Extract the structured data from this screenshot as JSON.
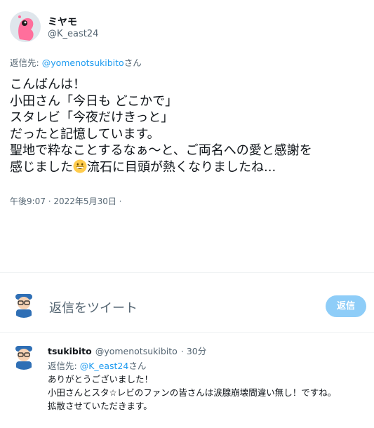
{
  "tweet": {
    "author_name": "ミヤモ",
    "author_handle": "@K_east24",
    "reply_prefix": "返信先: ",
    "reply_mention": "@yomenotsukibito",
    "reply_suffix": "さん",
    "body_lines": [
      "こんばんは！",
      "小田さん「今日も どこかで」",
      "スタレビ「今夜だけきっと」",
      "だったと記憶しています。",
      "聖地で粋なことするなぁ〜と、ご両名への愛と感謝を"
    ],
    "body_last_before": "感じました",
    "body_last_after": "流石に目頭が熱くなりましたね...",
    "emoji_icon": "grinning-face-emoji",
    "timestamp": "午後9:07 · 2022年5月30日 ·"
  },
  "composer": {
    "placeholder": "返信をツイート",
    "reply_button": "返信"
  },
  "reply_tweet": {
    "author_name": "tsukibito",
    "author_handle": "@yomenotsukibito",
    "time_ago": "· 30分",
    "reply_prefix": "返信先: ",
    "reply_mention": "@K_east24",
    "reply_suffix": "さん",
    "body_lines": [
      "ありがとうございました！",
      "小田さんとスタ☆レビのファンの皆さんは涙腺崩壊間違い無し！ですね。",
      "拡散させていただきます。"
    ]
  },
  "colors": {
    "accent": "#1d9bf0",
    "reply_button_disabled": "#8ecdf8",
    "secondary_text": "#536471"
  }
}
